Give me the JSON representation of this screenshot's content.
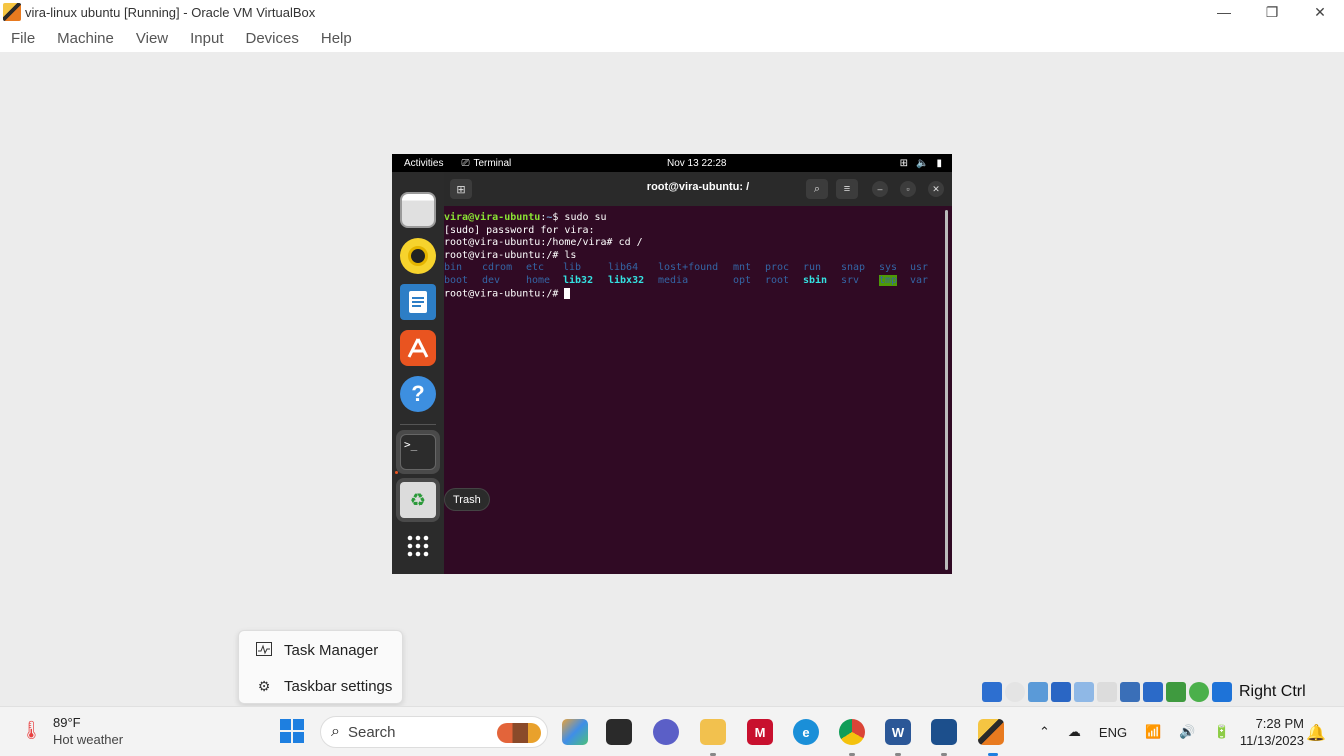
{
  "window": {
    "title": "vira-linux ubuntu [Running] - Oracle VM VirtualBox",
    "controls": [
      "—",
      "❐",
      "✕"
    ]
  },
  "menubar": [
    "File",
    "Machine",
    "View",
    "Input",
    "Devices",
    "Help"
  ],
  "guest": {
    "topbar": {
      "activities": "Activities",
      "app_name": "Terminal",
      "datetime": "Nov 13  22:28"
    },
    "dock_tooltip": "Trash",
    "terminal": {
      "title": "root@vira-ubuntu: /",
      "lines": {
        "l1_user": "vira@vira-ubuntu",
        "l1_sep": ":",
        "l1_path": "~",
        "l1_cmd": "$ sudo su",
        "l2": "[sudo] password for vira:",
        "l3": "root@vira-ubuntu:/home/vira# cd /",
        "l4": "root@vira-ubuntu:/# ls",
        "l7": "root@vira-ubuntu:/# "
      },
      "ls_row1": [
        "bin",
        "cdrom",
        "etc",
        "lib",
        "lib64",
        "lost+found",
        "mnt",
        "proc",
        "run",
        "snap",
        "sys",
        "usr"
      ],
      "ls_row2": [
        "boot",
        "dev",
        "home",
        "lib32",
        "libx32",
        "media",
        "opt",
        "root",
        "sbin",
        "srv",
        "tmp",
        "var"
      ]
    }
  },
  "context_menu": {
    "items": [
      {
        "label": "Task Manager",
        "icon": "task-manager-icon"
      },
      {
        "label": "Taskbar settings",
        "icon": "gear-icon"
      }
    ]
  },
  "vbox_status": {
    "host_key": "Right Ctrl"
  },
  "taskbar": {
    "weather_temp": "89°F",
    "weather_cond": "Hot weather",
    "search_label": "Search",
    "tray_lang": "ENG",
    "time": "7:28 PM",
    "date": "11/13/2023"
  }
}
